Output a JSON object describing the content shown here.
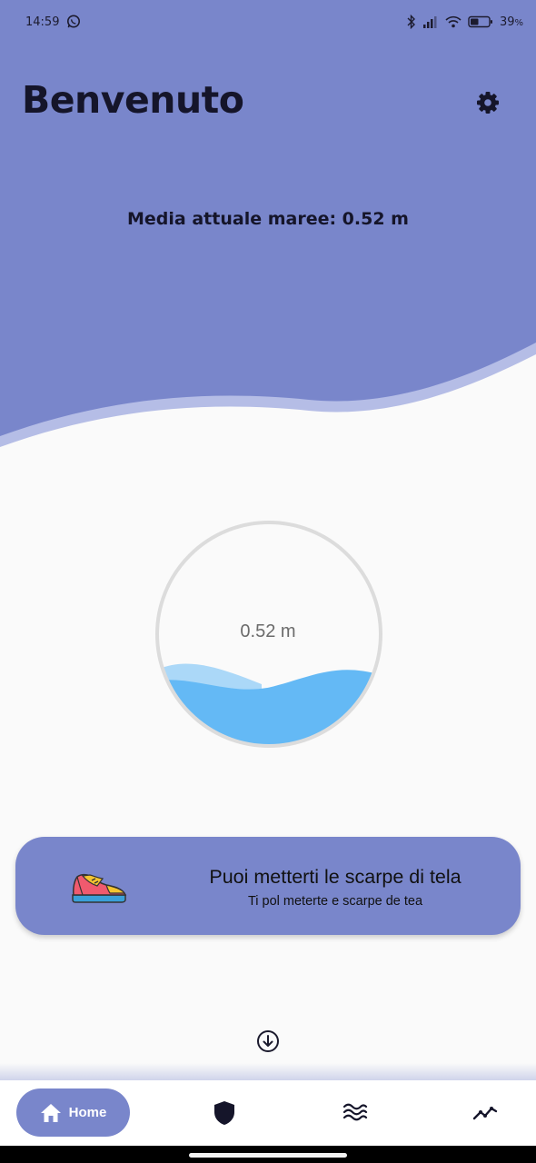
{
  "status_bar": {
    "time": "14:59",
    "battery_percent": "39",
    "battery_suffix": "%",
    "icons": [
      "whatsapp-icon",
      "bluetooth-icon",
      "signal-icon",
      "wifi-icon",
      "battery-icon"
    ]
  },
  "header": {
    "title": "Benvenuto",
    "settings_icon": "gear-icon",
    "tide_average_text": "Media attuale maree: 0.52 m"
  },
  "gauge": {
    "label": "0.52 m",
    "level_fraction": 0.28
  },
  "advice": {
    "icon": "sneaker-icon",
    "title": "Puoi metterti le scarpe di tela",
    "subtitle": "Ti pol meterte e scarpe de tea"
  },
  "scroll_icon": "arrow-down-circle-icon",
  "bottom_nav": {
    "home_label": "Home",
    "items": [
      "home-icon",
      "shield-icon",
      "waves-icon",
      "trend-line-icon"
    ]
  },
  "colors": {
    "primary": "#7986cb",
    "primary_light": "#b5bde6",
    "water": "#64b9f5",
    "water_light": "#abd8f8",
    "background": "#fafafa"
  }
}
